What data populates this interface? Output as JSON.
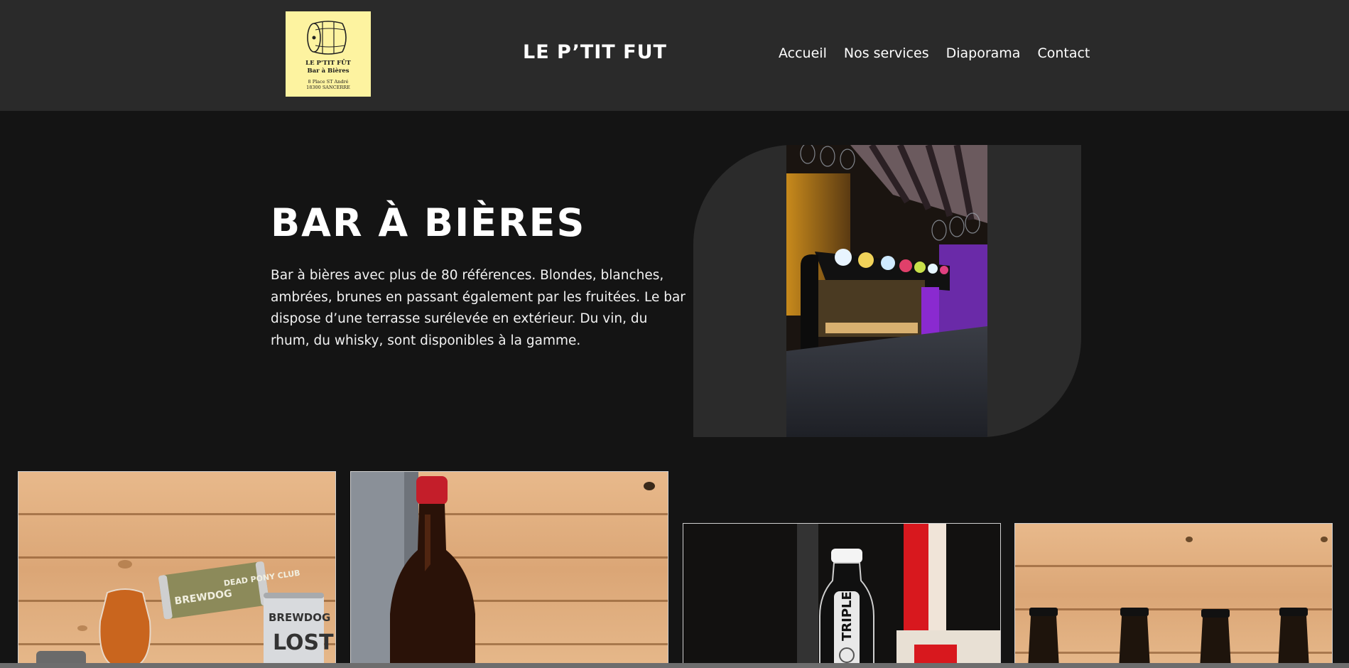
{
  "header": {
    "logo": {
      "name_line1": "LE P'TIT FÛT",
      "name_line2": "Bar à Bières",
      "address_line1": "8 Place ST André",
      "address_line2": "18300 SANCERRE",
      "background": "#fdf3a0"
    },
    "title": "LE P’TIT FUT",
    "nav": [
      "Accueil",
      "Nos services",
      "Diaporama",
      "Contact"
    ],
    "background": "#2a2a2a"
  },
  "hero": {
    "title": "BAR À BIÈRES",
    "text": "Bar à bières avec plus de 80 références. Blondes, blanches, ambrées, brunes en passant également par les fruitées. Le bar dispose d’une terrasse surélevée en extérieur. Du vin, du rhum, du whisky, sont disponibles à la gamme.",
    "photo_icon": "bar-tap-photo"
  },
  "gallery": {
    "items": [
      {
        "icon": "brewdog-cans-photo",
        "can1_brand": "BREWDOG",
        "can1_name": "DEAD PONY CLUB",
        "can2_brand": "BREWDOG",
        "can2_name": "LOST"
      },
      {
        "icon": "dark-beer-bottle-photo"
      },
      {
        "icon": "triple-beer-bottle-photo",
        "label": "TRIPLE"
      },
      {
        "icon": "beer-bottles-row-photo"
      }
    ]
  },
  "colors": {
    "page_background": "#141414",
    "text": "#ffffff",
    "hero_shape": "#2b2b2b"
  }
}
